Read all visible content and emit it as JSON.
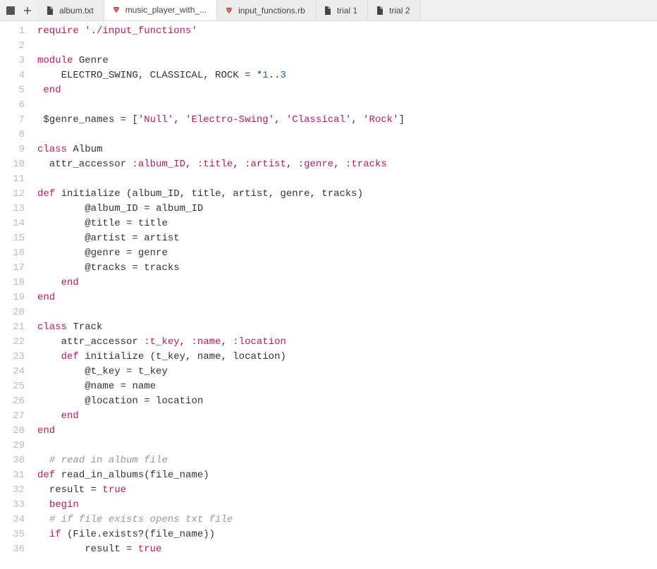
{
  "icons": {
    "menu": "menu-icon",
    "plus": "plus-icon",
    "file": "file-icon",
    "ruby": "ruby-icon"
  },
  "tabs": [
    {
      "label": "album.txt",
      "icon": "file-icon",
      "active": false
    },
    {
      "label": "music_player_with_...",
      "icon": "ruby-icon",
      "active": true
    },
    {
      "label": "input_functions.rb",
      "icon": "ruby-icon",
      "active": false
    },
    {
      "label": "trial 1",
      "icon": "file-icon",
      "active": false
    },
    {
      "label": "trial 2",
      "icon": "file-icon",
      "active": false
    }
  ],
  "lines": [
    {
      "n": 1,
      "seg": [
        [
          "kw",
          "require"
        ],
        [
          "pl",
          " "
        ],
        [
          "str",
          "'./input_functions'"
        ]
      ]
    },
    {
      "n": 2,
      "seg": []
    },
    {
      "n": 3,
      "seg": [
        [
          "kw",
          "module"
        ],
        [
          "pl",
          " "
        ],
        [
          "cls",
          "Genre"
        ]
      ]
    },
    {
      "n": 4,
      "seg": [
        [
          "pl",
          "    ELECTRO_SWING, CLASSICAL, ROCK = *"
        ],
        [
          "num",
          "1"
        ],
        [
          "pl",
          ".."
        ],
        [
          "num",
          "3"
        ]
      ]
    },
    {
      "n": 5,
      "seg": [
        [
          "pl",
          " "
        ],
        [
          "kw",
          "end"
        ]
      ]
    },
    {
      "n": 6,
      "seg": []
    },
    {
      "n": 7,
      "seg": [
        [
          "pl",
          " $genre_names = ["
        ],
        [
          "str",
          "'Null'"
        ],
        [
          "pl",
          ", "
        ],
        [
          "str",
          "'Electro-Swing'"
        ],
        [
          "pl",
          ", "
        ],
        [
          "str",
          "'Classical'"
        ],
        [
          "pl",
          ", "
        ],
        [
          "str",
          "'Rock'"
        ],
        [
          "pl",
          "]"
        ]
      ]
    },
    {
      "n": 8,
      "seg": []
    },
    {
      "n": 9,
      "seg": [
        [
          "kw",
          "class"
        ],
        [
          "pl",
          " "
        ],
        [
          "cls",
          "Album"
        ]
      ]
    },
    {
      "n": 10,
      "seg": [
        [
          "pl",
          "  attr_accessor "
        ],
        [
          "sym",
          ":album_ID"
        ],
        [
          "pl",
          ", "
        ],
        [
          "sym",
          ":title"
        ],
        [
          "pl",
          ", "
        ],
        [
          "sym",
          ":artist"
        ],
        [
          "pl",
          ", "
        ],
        [
          "sym",
          ":genre"
        ],
        [
          "pl",
          ", "
        ],
        [
          "sym",
          ":tracks"
        ]
      ]
    },
    {
      "n": 11,
      "seg": []
    },
    {
      "n": 12,
      "seg": [
        [
          "kw",
          "def"
        ],
        [
          "pl",
          " "
        ],
        [
          "def",
          "initialize"
        ],
        [
          "pl",
          " (album_ID, title, artist, genre, tracks)"
        ]
      ]
    },
    {
      "n": 13,
      "seg": [
        [
          "pl",
          "        "
        ],
        [
          "at",
          "@album_ID"
        ],
        [
          "pl",
          " = album_ID"
        ]
      ]
    },
    {
      "n": 14,
      "seg": [
        [
          "pl",
          "        "
        ],
        [
          "at",
          "@title"
        ],
        [
          "pl",
          " = title"
        ]
      ]
    },
    {
      "n": 15,
      "seg": [
        [
          "pl",
          "        "
        ],
        [
          "at",
          "@artist"
        ],
        [
          "pl",
          " = artist"
        ]
      ]
    },
    {
      "n": 16,
      "seg": [
        [
          "pl",
          "        "
        ],
        [
          "at",
          "@genre"
        ],
        [
          "pl",
          " = genre"
        ]
      ]
    },
    {
      "n": 17,
      "seg": [
        [
          "pl",
          "        "
        ],
        [
          "at",
          "@tracks"
        ],
        [
          "pl",
          " = tracks"
        ]
      ]
    },
    {
      "n": 18,
      "seg": [
        [
          "pl",
          "    "
        ],
        [
          "kw",
          "end"
        ]
      ]
    },
    {
      "n": 19,
      "seg": [
        [
          "kw",
          "end"
        ]
      ]
    },
    {
      "n": 20,
      "seg": []
    },
    {
      "n": 21,
      "seg": [
        [
          "kw",
          "class"
        ],
        [
          "pl",
          " "
        ],
        [
          "cls",
          "Track"
        ]
      ]
    },
    {
      "n": 22,
      "seg": [
        [
          "pl",
          "    attr_accessor "
        ],
        [
          "sym",
          ":t_key"
        ],
        [
          "pl",
          ", "
        ],
        [
          "sym",
          ":name"
        ],
        [
          "pl",
          ", "
        ],
        [
          "sym",
          ":location"
        ]
      ]
    },
    {
      "n": 23,
      "seg": [
        [
          "pl",
          "    "
        ],
        [
          "kw",
          "def"
        ],
        [
          "pl",
          " "
        ],
        [
          "def",
          "initialize"
        ],
        [
          "pl",
          " (t_key, name, location)"
        ]
      ]
    },
    {
      "n": 24,
      "seg": [
        [
          "pl",
          "        "
        ],
        [
          "at",
          "@t_key"
        ],
        [
          "pl",
          " = t_key"
        ]
      ]
    },
    {
      "n": 25,
      "seg": [
        [
          "pl",
          "        "
        ],
        [
          "at",
          "@name"
        ],
        [
          "pl",
          " = name"
        ]
      ]
    },
    {
      "n": 26,
      "seg": [
        [
          "pl",
          "        "
        ],
        [
          "at",
          "@location"
        ],
        [
          "pl",
          " = location"
        ]
      ]
    },
    {
      "n": 27,
      "seg": [
        [
          "pl",
          "    "
        ],
        [
          "kw",
          "end"
        ]
      ]
    },
    {
      "n": 28,
      "seg": [
        [
          "kw",
          "end"
        ]
      ]
    },
    {
      "n": 29,
      "seg": []
    },
    {
      "n": 30,
      "seg": [
        [
          "pl",
          "  "
        ],
        [
          "com",
          "# read in album file"
        ]
      ]
    },
    {
      "n": 31,
      "seg": [
        [
          "kw",
          "def"
        ],
        [
          "pl",
          " "
        ],
        [
          "def",
          "read_in_albums"
        ],
        [
          "pl",
          "(file_name)"
        ]
      ]
    },
    {
      "n": 32,
      "seg": [
        [
          "pl",
          "  result = "
        ],
        [
          "const",
          "true"
        ]
      ]
    },
    {
      "n": 33,
      "seg": [
        [
          "pl",
          "  "
        ],
        [
          "kw",
          "begin"
        ]
      ]
    },
    {
      "n": 34,
      "seg": [
        [
          "pl",
          "  "
        ],
        [
          "com",
          "# if file exists opens txt file"
        ]
      ]
    },
    {
      "n": 35,
      "seg": [
        [
          "pl",
          "  "
        ],
        [
          "kw",
          "if"
        ],
        [
          "pl",
          " (File.exists?(file_name))"
        ]
      ]
    },
    {
      "n": 36,
      "seg": [
        [
          "pl",
          "        result = "
        ],
        [
          "const",
          "true"
        ]
      ]
    }
  ]
}
